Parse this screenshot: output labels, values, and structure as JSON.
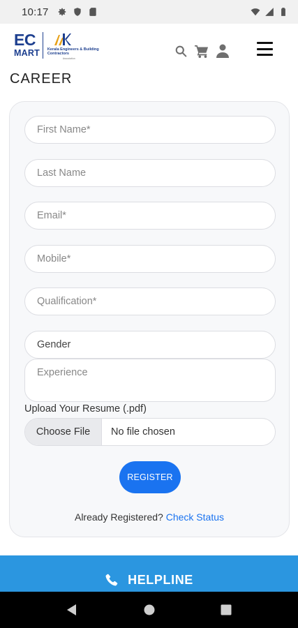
{
  "status_bar": {
    "time": "10:17",
    "icons_left": [
      "gear-icon",
      "shield-icon",
      "sd-card-icon"
    ],
    "icons_right": [
      "wifi-icon",
      "signal-icon",
      "battery-icon"
    ]
  },
  "header": {
    "logo": {
      "line1": "EC",
      "line2": "MART",
      "org": "Kerala Engineers & Building Contractors",
      "org_sub": "Association"
    },
    "icons": [
      "search-icon",
      "cart-icon",
      "user-icon"
    ],
    "menu_icon": "hamburger-menu-icon"
  },
  "page": {
    "title": "CAREER"
  },
  "form": {
    "first_name": {
      "placeholder": "First Name*",
      "value": ""
    },
    "last_name": {
      "placeholder": "Last Name",
      "value": ""
    },
    "email": {
      "placeholder": "Email*",
      "value": ""
    },
    "mobile": {
      "placeholder": "Mobile*",
      "value": ""
    },
    "qualification": {
      "placeholder": "Qualification*",
      "value": ""
    },
    "gender": {
      "selected": "Gender"
    },
    "experience": {
      "placeholder": "Experience",
      "value": ""
    },
    "upload_label": "Upload Your Resume (.pdf)",
    "file_button": "Choose File",
    "file_status": "No file chosen",
    "register": "REGISTER",
    "already_text": "Already Registered?",
    "check_status": "Check Status"
  },
  "helpline": {
    "label": "HELPLINE",
    "icon": "phone-icon"
  },
  "nav_bar": {
    "buttons": [
      "back-icon",
      "home-icon",
      "recents-icon"
    ]
  },
  "colors": {
    "primary": "#1a73f0",
    "helpline_bg": "#2b96e0",
    "brand_blue": "#1d3f8f",
    "card_bg": "#f7f8fa"
  }
}
